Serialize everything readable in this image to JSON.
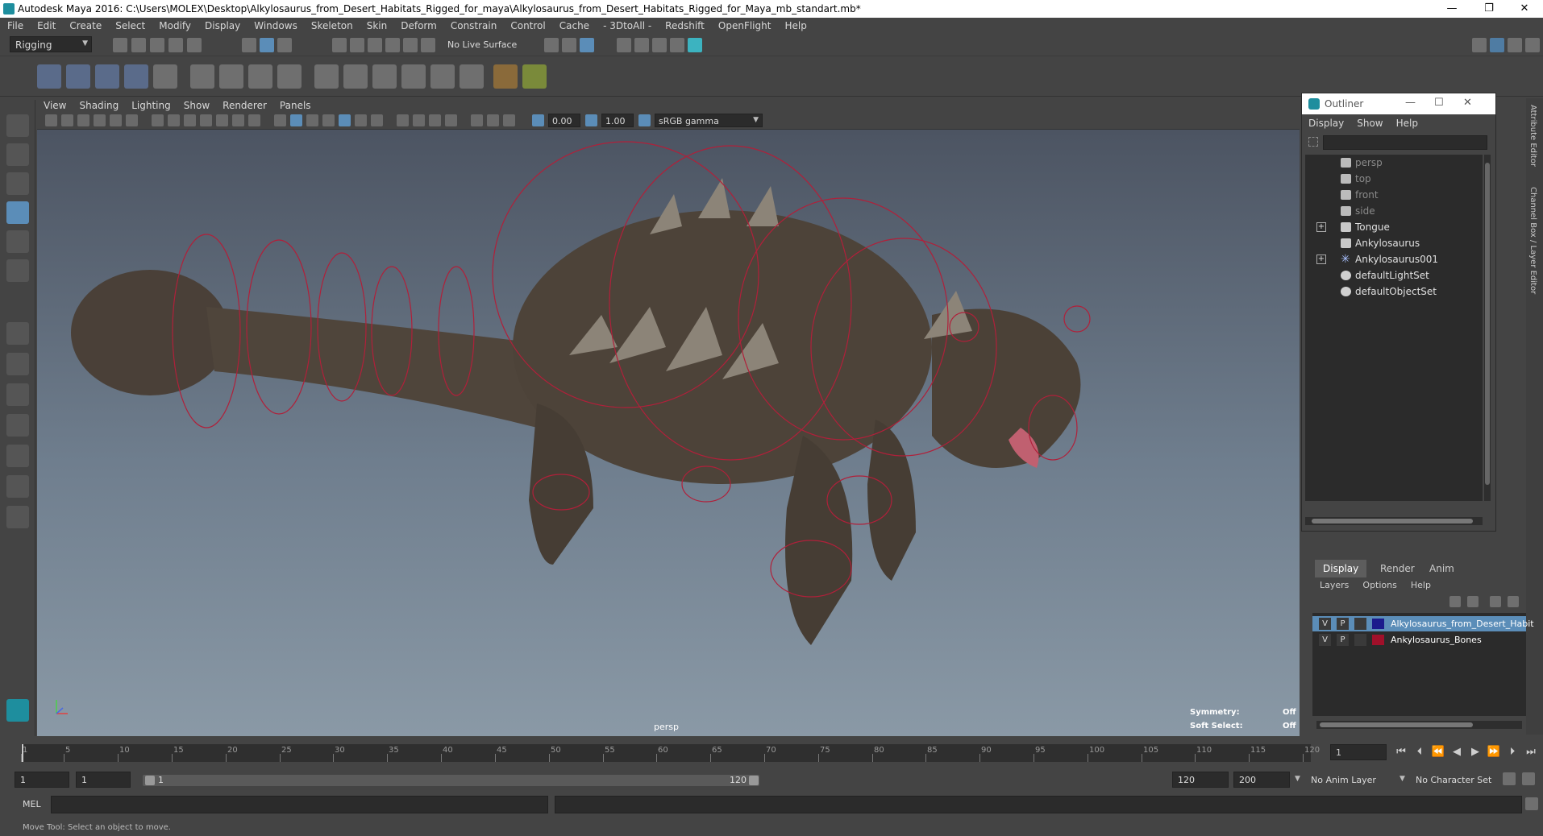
{
  "titlebar": {
    "title": "Autodesk Maya 2016: C:\\Users\\MOLEX\\Desktop\\Alkylosaurus_from_Desert_Habitats_Rigged_for_maya\\Alkylosaurus_from_Desert_Habitats_Rigged_for_Maya_mb_standart.mb*",
    "minimize": "—",
    "restore": "❐",
    "close": "✕"
  },
  "menubar": {
    "items": [
      "File",
      "Edit",
      "Create",
      "Select",
      "Modify",
      "Display",
      "Windows",
      "Skeleton",
      "Skin",
      "Deform",
      "Constrain",
      "Control",
      "Cache",
      "- 3DtoAll -",
      "Redshift",
      "OpenFlight",
      "Help"
    ]
  },
  "statusline": {
    "menuset": "Rigging",
    "live_surface": "No Live Surface"
  },
  "viewport": {
    "menu": [
      "View",
      "Shading",
      "Lighting",
      "Show",
      "Renderer",
      "Panels"
    ],
    "near_value": "0.00",
    "far_value": "1.00",
    "color_space": "sRGB gamma",
    "camera_label": "persp",
    "hud": {
      "symmetry_label": "Symmetry:",
      "symmetry_value": "Off",
      "soft_select_label": "Soft Select:",
      "soft_select_value": "Off"
    }
  },
  "outliner": {
    "title": "Outliner",
    "menu": [
      "Display",
      "Show",
      "Help"
    ],
    "nodes": [
      {
        "label": "persp",
        "icon": "camera-icon",
        "dim": true,
        "expand": false
      },
      {
        "label": "top",
        "icon": "camera-icon",
        "dim": true,
        "expand": false
      },
      {
        "label": "front",
        "icon": "camera-icon",
        "dim": true,
        "expand": false
      },
      {
        "label": "side",
        "icon": "camera-icon",
        "dim": true,
        "expand": false
      },
      {
        "label": "Tongue",
        "icon": "group-icon",
        "dim": false,
        "expand": true
      },
      {
        "label": "Ankylosaurus",
        "icon": "group-icon",
        "dim": false,
        "expand": false
      },
      {
        "label": "Ankylosaurus001",
        "icon": "joint-icon",
        "dim": false,
        "expand": true
      },
      {
        "label": "defaultLightSet",
        "icon": "set-icon",
        "dim": false,
        "expand": false
      },
      {
        "label": "defaultObjectSet",
        "icon": "set-icon",
        "dim": false,
        "expand": false
      }
    ]
  },
  "side_tabs": {
    "attribute_editor": "Attribute Editor",
    "channel_box": "Channel Box / Layer Editor"
  },
  "layer_editor": {
    "tabs": [
      "Display",
      "Render",
      "Anim"
    ],
    "menu": [
      "Layers",
      "Options",
      "Help"
    ],
    "layers": [
      {
        "v": "V",
        "p": "P",
        "color": "#1b1b8c",
        "name": "Alkylosaurus_from_Desert_Habit",
        "selected": true
      },
      {
        "v": "V",
        "p": "P",
        "color": "#a0102a",
        "name": "Ankylosaurus_Bones",
        "selected": false
      }
    ]
  },
  "timeslider": {
    "ticks": [
      "1",
      "5",
      "10",
      "15",
      "20",
      "25",
      "30",
      "35",
      "40",
      "45",
      "50",
      "55",
      "60",
      "65",
      "70",
      "75",
      "80",
      "85",
      "90",
      "95",
      "100",
      "105",
      "110",
      "115",
      "120"
    ],
    "current_frame": "1"
  },
  "rangebar": {
    "start_frame": "1",
    "range_start": "1",
    "slider_start": "1",
    "slider_end": "120",
    "range_end": "120",
    "end_frame": "200",
    "anim_layer": "No Anim Layer",
    "character_set": "No Character Set"
  },
  "cmdline": {
    "label": "MEL"
  },
  "helpline": {
    "text": "Move Tool: Select an object to move."
  },
  "colors": {
    "ui_bg": "#444444",
    "field_bg": "#2b2b2b",
    "accent": "#5b8db8",
    "rig_curve": "#b0203a"
  }
}
